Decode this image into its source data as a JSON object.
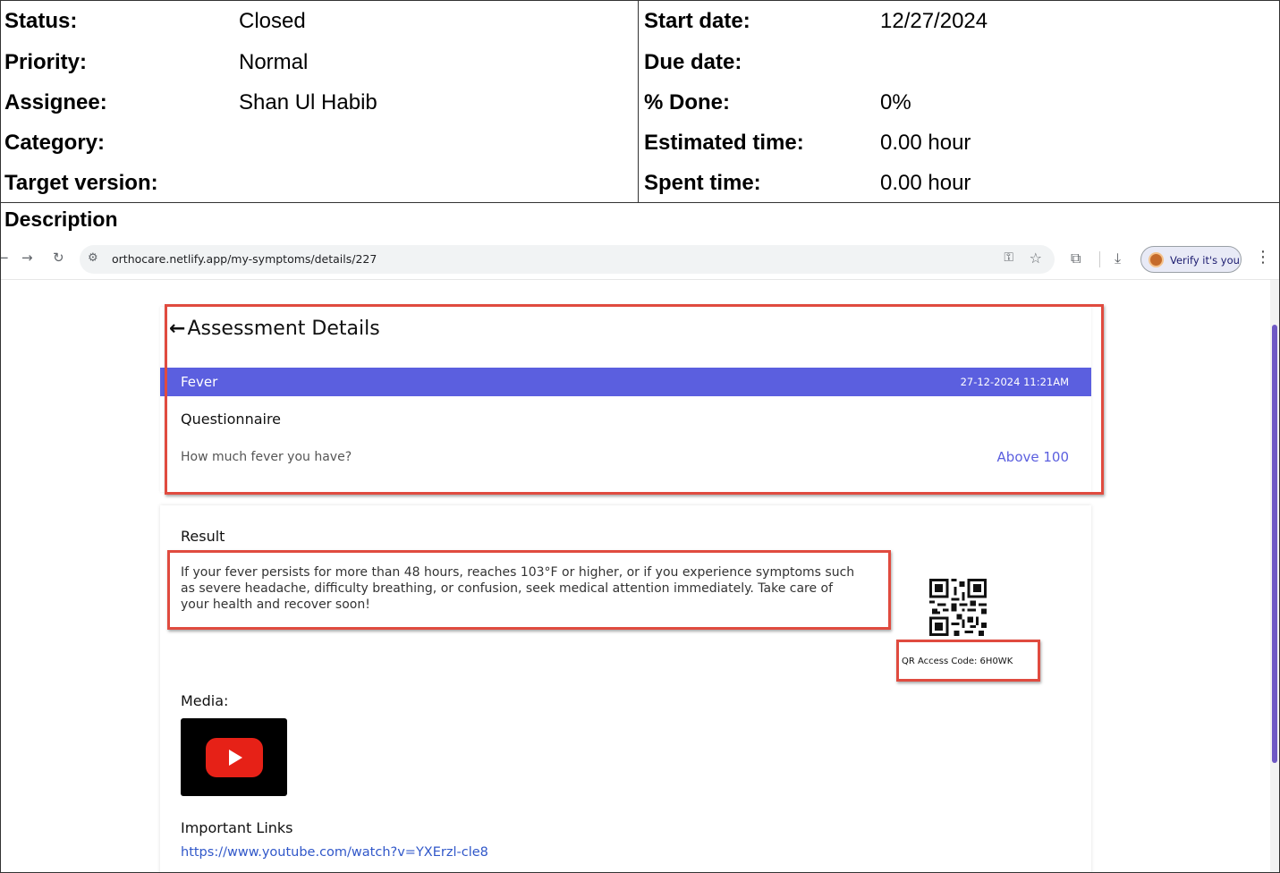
{
  "attributes": {
    "left": [
      {
        "label": "Status:",
        "value": "Closed"
      },
      {
        "label": "Priority:",
        "value": "Normal"
      },
      {
        "label": "Assignee:",
        "value": "Shan Ul Habib"
      },
      {
        "label": "Category:",
        "value": ""
      },
      {
        "label": "Target version:",
        "value": ""
      }
    ],
    "right": [
      {
        "label": "Start date:",
        "value": "12/27/2024"
      },
      {
        "label": "Due date:",
        "value": ""
      },
      {
        "label": "% Done:",
        "value": "0%"
      },
      {
        "label": "Estimated time:",
        "value": "0.00 hour"
      },
      {
        "label": "Spent time:",
        "value": "0.00 hour"
      }
    ]
  },
  "description_label": "Description",
  "browser": {
    "url": "orthocare.netlify.app/my-symptoms/details/227",
    "verify_label": "Verify it's you"
  },
  "assessment": {
    "title": "Assessment Details",
    "symptom": "Fever",
    "datetime": "27-12-2024 11:21AM",
    "questionnaire_title": "Questionnaire",
    "question": "How much fever you have?",
    "answer": "Above 100"
  },
  "result": {
    "title": "Result",
    "text": "If your fever persists for more than 48 hours, reaches 103°F or higher, or if you experience symptoms such as severe headache, difficulty breathing, or confusion, seek medical attention immediately. Take care of your health and recover soon!",
    "qr_code_label": "QR Access Code: 6H0WK"
  },
  "media": {
    "title": "Media:",
    "icon": "youtube-play-icon"
  },
  "links": {
    "title": "Important Links",
    "items": [
      "https://www.youtube.com/watch?v=YXErzl-cle8"
    ]
  },
  "colors": {
    "accent": "#5b5fdf",
    "annotation": "#e04b3f",
    "link": "#3057c9"
  }
}
